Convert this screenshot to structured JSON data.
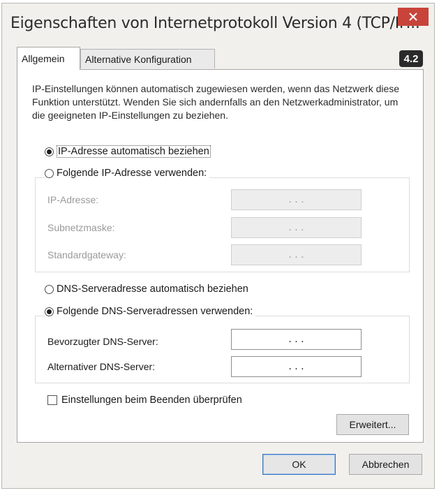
{
  "window": {
    "title": "Eigenschaften von Internetprotokoll Version 4 (TCP/IP..."
  },
  "tabs": [
    {
      "label": "Allgemein"
    },
    {
      "label": "Alternative Konfiguration"
    }
  ],
  "badge": "4.2",
  "description": "IP-Einstellungen können automatisch zugewiesen werden, wenn das Netzwerk diese Funktion unterstützt. Wenden Sie sich andernfalls an den Netzwerkadministrator, um die geeigneten IP-Einstellungen zu beziehen.",
  "ip": {
    "auto_label": "IP-Adresse automatisch beziehen",
    "auto_selected": true,
    "manual_label": "Folgende IP-Adresse verwenden:",
    "fields": [
      {
        "label": "IP-Adresse:",
        "value": ". . ."
      },
      {
        "label": "Subnetzmaske:",
        "value": ". . ."
      },
      {
        "label": "Standardgateway:",
        "value": ". . ."
      }
    ]
  },
  "dns": {
    "auto_label": "DNS-Serveradresse automatisch beziehen",
    "manual_label": "Folgende DNS-Serveradressen verwenden:",
    "manual_selected": true,
    "fields": [
      {
        "label": "Bevorzugter DNS-Server:",
        "value": ". . ."
      },
      {
        "label": "Alternativer DNS-Server:",
        "value": ". . ."
      }
    ]
  },
  "validate_checkbox": {
    "label": "Einstellungen beim Beenden überprüfen",
    "checked": false
  },
  "buttons": {
    "advanced": "Erweitert...",
    "ok": "OK",
    "cancel": "Abbrechen"
  },
  "colors": {
    "close_button": "#c8443a",
    "window_bg": "#f1f0ec",
    "default_button_border": "#3d76c2"
  }
}
